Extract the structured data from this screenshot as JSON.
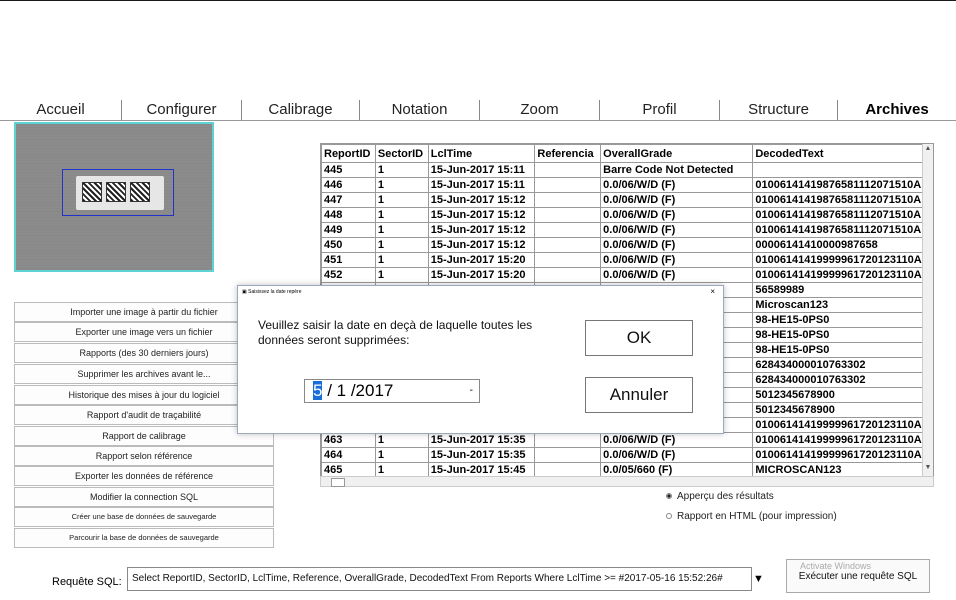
{
  "tabs": [
    "Accueil",
    "Configurer",
    "Calibrage",
    "Notation",
    "Zoom",
    "Profil",
    "Structure",
    "Archives"
  ],
  "active_tab": "Archives",
  "left_buttons": [
    "Importer une image à partir du fichier",
    "Exporter une image vers un fichier",
    "Rapports (des 30 derniers jours)",
    "Supprimer les archives avant le...",
    "Historique des mises à jour du logiciel",
    "Rapport d'audit de traçabilité",
    "Rapport de calibrage",
    "Rapport selon référence",
    "Exporter les données de référence",
    "Modifier la connection SQL",
    "Créer une base de données de sauvegarde",
    "Parcourir la base de données de sauvegarde"
  ],
  "table": {
    "columns": [
      "ReportID",
      "SectorID",
      "LclTime",
      "Referencia",
      "OverallGrade",
      "DecodedText"
    ],
    "rows": [
      [
        "445",
        "1",
        "15-Jun-2017 15:11",
        "",
        "Barre Code Not Detected",
        ""
      ],
      [
        "446",
        "1",
        "15-Jun-2017 15:11",
        "",
        "0.0/06/W/D (F)",
        "0100614141987658111207151​0A"
      ],
      [
        "447",
        "1",
        "15-Jun-2017 15:12",
        "",
        "0.0/06/W/D (F)",
        "0100614141987658111207151​0A"
      ],
      [
        "448",
        "1",
        "15-Jun-2017 15:12",
        "",
        "0.0/06/W/D (F)",
        "0100614141987658111207151​0A"
      ],
      [
        "449",
        "1",
        "15-Jun-2017 15:12",
        "",
        "0.0/06/W/D (F)",
        "0100614141987658111207151​0A"
      ],
      [
        "450",
        "1",
        "15-Jun-2017 15:12",
        "",
        "0.0/06/W/D (F)",
        "00006141410000987658"
      ],
      [
        "451",
        "1",
        "15-Jun-2017 15:20",
        "",
        "0.0/06/W/D (F)",
        "0100614141999996172012311​0A"
      ],
      [
        "452",
        "1",
        "15-Jun-2017 15:20",
        "",
        "0.0/06/W/D (F)",
        "0100614141999996172012311​0A"
      ],
      [
        "",
        "",
        "",
        "",
        "",
        "56589989"
      ],
      [
        "",
        "",
        "",
        "",
        "",
        "Microscan123"
      ],
      [
        "",
        "",
        "",
        "",
        "",
        "98-HE15-0PS0"
      ],
      [
        "",
        "",
        "",
        "",
        "",
        "98-HE15-0PS0"
      ],
      [
        "",
        "",
        "",
        "",
        "",
        "98-HE15-0PS0"
      ],
      [
        "",
        "",
        "",
        "",
        "",
        "628434000010763302"
      ],
      [
        "",
        "",
        "",
        "",
        "",
        "628434000010763302"
      ],
      [
        "",
        "",
        "",
        "",
        "",
        "5012345678900"
      ],
      [
        "",
        "",
        "",
        "",
        "",
        "5012345678900"
      ],
      [
        "",
        "",
        "",
        "",
        "",
        "0100614141999996172012311​0A"
      ],
      [
        "463",
        "1",
        "15-Jun-2017 15:35",
        "",
        "0.0/06/W/D (F)",
        "0100614141999996172012311​0A"
      ],
      [
        "464",
        "1",
        "15-Jun-2017 15:35",
        "",
        "0.0/06/W/D (F)",
        "0100614141999996172012311​0A"
      ],
      [
        "465",
        "1",
        "15-Jun-2017 15:45",
        "",
        "0.0/05/660 (F)",
        "MICROSCAN123"
      ]
    ]
  },
  "dialog": {
    "title": "Saisissez la date repère",
    "message": "Veuillez saisir la date en deçà de laquelle toutes les données seront supprimées:",
    "date_month": "5",
    "date_rest": " / 1 /2017",
    "ok_label": "OK",
    "cancel_label": "Annuler",
    "close_glyph": "×"
  },
  "options": {
    "preview_label": "Apperçu des résultats",
    "html_label": "Rapport en HTML (pour impression)",
    "selected": "preview"
  },
  "sql": {
    "label": "Requête SQL:",
    "query": "Select ReportID, SectorID, LclTime, Reference, OverallGrade, DecodedText From Reports Where LclTime >= #2017-05-16 15:52:26#",
    "run_label": "Exécuter une requête SQL",
    "watermark": "Activate Windows"
  }
}
